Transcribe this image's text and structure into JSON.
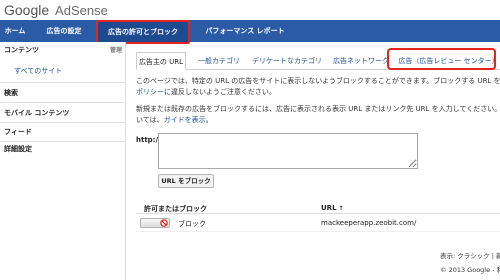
{
  "brand": {
    "google": "Google",
    "product": "AdSense"
  },
  "topnav": {
    "home": "ホーム",
    "settings": "広告の設定",
    "allow_block": "広告の許可とブロック",
    "performance": "パフォーマンス レポート"
  },
  "sidebar": {
    "contents_title": "コンテンツ",
    "contents_meta": "管理",
    "all_sites": "すべてのサイト",
    "search": "検索",
    "mobile": "モバイル コンテンツ",
    "feed": "フィード",
    "advanced": "詳細設定"
  },
  "tabs": {
    "advertiser_url": "広告主の URL",
    "general_category": "一般カテゴリ",
    "sensitive_category": "デリケートなカテゴリ",
    "ad_networks": "広告ネットワーク",
    "ad_review": "広告（広告レビュー センター）"
  },
  "description": {
    "line1": "このページでは、特定の URL の広告をサイトに表示しないようブロックすることができます。ブロックする URL を",
    "line2_link": "ポリシー",
    "line2_rest": "に違反しないようご注意ください。",
    "line3": "新規または既存の広告をブロックするには、広告に表示される表示 URL またはリンク先 URL を入力してください。",
    "line4_start": "いては、",
    "line4_link": "ガイドを表示",
    "line4_end": "。"
  },
  "form": {
    "http_label": "http://",
    "url_value": "",
    "block_button": "URL をブロック"
  },
  "table": {
    "col_status": "許可またはブロック",
    "col_url": "URL",
    "sort_indicator": "↑",
    "rows": [
      {
        "status": "ブロック",
        "url": "mackeeperapp.zeobit.com/"
      }
    ]
  },
  "footer": {
    "display": "表示: クラシック | 新",
    "copyright": "© 2013 Google - 利"
  },
  "colors": {
    "nav_bg": "#2c5ba6",
    "highlight_red": "#e3231c",
    "link_blue": "#1f4d9e"
  }
}
